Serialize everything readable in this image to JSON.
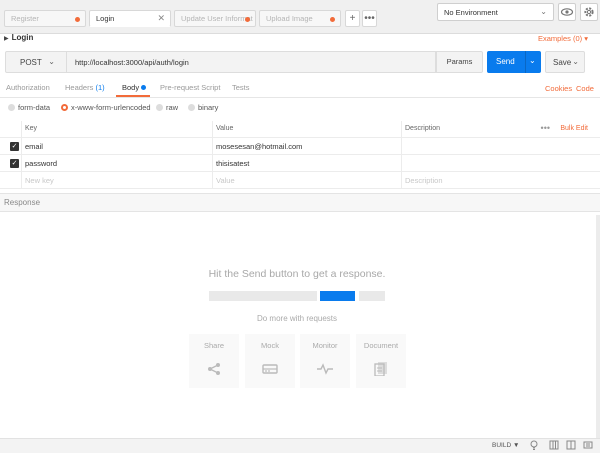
{
  "tabs": [
    {
      "label": "Register",
      "state": "unsaved"
    },
    {
      "label": "Login",
      "state": "active"
    },
    {
      "label": "Update User Informat",
      "state": "unsaved"
    },
    {
      "label": "Upload Image",
      "state": "unsaved"
    }
  ],
  "environment": {
    "selected": "No Environment"
  },
  "request": {
    "title": "Login",
    "examples_label": "Examples (0)",
    "method": "POST",
    "url": "http://localhost:3000/api/auth/login",
    "params_label": "Params",
    "send_label": "Send",
    "save_label": "Save"
  },
  "request_tabs": {
    "authorization": "Authorization",
    "headers": "Headers",
    "headers_count": "(1)",
    "body": "Body",
    "prerequest": "Pre-request Script",
    "tests": "Tests",
    "cookies": "Cookies",
    "code": "Code"
  },
  "body_types": {
    "form_data": "form-data",
    "urlencoded": "x-www-form-urlencoded",
    "raw": "raw",
    "binary": "binary",
    "selected": "x-www-form-urlencoded"
  },
  "kv_table": {
    "headers": {
      "key": "Key",
      "value": "Value",
      "description": "Description",
      "bulk_edit": "Bulk Edit"
    },
    "rows": [
      {
        "key": "email",
        "value": "mosesesan@hotmail.com",
        "description": "",
        "enabled": true
      },
      {
        "key": "password",
        "value": "thisisatest",
        "description": "",
        "enabled": true
      }
    ],
    "placeholders": {
      "key": "New key",
      "value": "Value",
      "description": "Description"
    }
  },
  "response": {
    "header": "Response",
    "hint": "Hit the Send button to get a response.",
    "do_more": "Do more with requests",
    "cards": [
      {
        "label": "Share",
        "icon": "share-icon"
      },
      {
        "label": "Mock",
        "icon": "mock-server-icon"
      },
      {
        "label": "Monitor",
        "icon": "monitor-pulse-icon"
      },
      {
        "label": "Document",
        "icon": "document-icon"
      }
    ]
  },
  "statusbar": {
    "build_label": "BUILD ▼"
  },
  "colors": {
    "accent": "#f26b3a",
    "primary": "#097bed"
  }
}
